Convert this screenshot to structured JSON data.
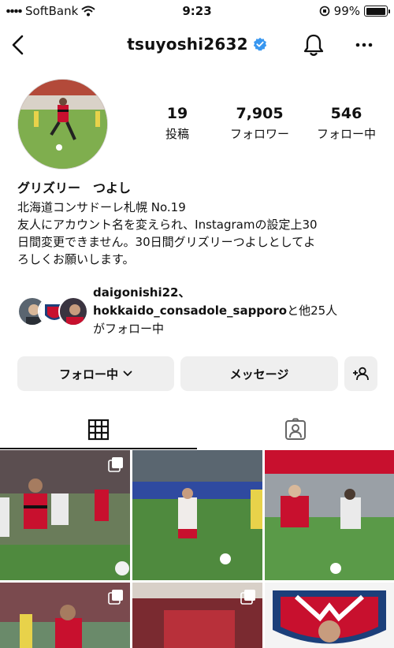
{
  "status_bar": {
    "carrier": "SoftBank",
    "time": "9:23",
    "battery": "99%",
    "battery_level": 0.99
  },
  "header": {
    "username": "tsuyoshi2632",
    "verified": true,
    "icons": [
      "back-chevron-icon",
      "verified-badge-icon",
      "bell-icon",
      "more-horizontal-icon"
    ]
  },
  "profile": {
    "stats": {
      "posts_count": "19",
      "posts_label": "投稿",
      "followers_count": "7,905",
      "followers_label": "フォロワー",
      "following_count": "546",
      "following_label": "フォロー中"
    },
    "bio": {
      "name": "グリズリー　つよし",
      "lines": [
        "北海道コンサドーレ札幌 No.19",
        "友人にアカウント名を変えられ、Instagramの設定上30",
        "日間変更できません。30日間グリズリーつよしとしてよ",
        "ろしくお願いします。"
      ]
    },
    "followed_by": {
      "user1": "daigonishi22、",
      "user2": "hokkaido_consadole_sapporo",
      "others": "と他25人",
      "suffix": "がフォロー中"
    }
  },
  "actions": {
    "follow_label": "フォロー中",
    "message_label": "メッセージ"
  },
  "tabs": [
    {
      "name": "posts-grid",
      "icon": "grid-icon",
      "active": true
    },
    {
      "name": "tagged",
      "icon": "tagged-person-icon",
      "active": false
    }
  ],
  "colors": {
    "accent_red": "#c8102e",
    "verified_blue": "#3897f0",
    "button_bg": "#efefef"
  }
}
